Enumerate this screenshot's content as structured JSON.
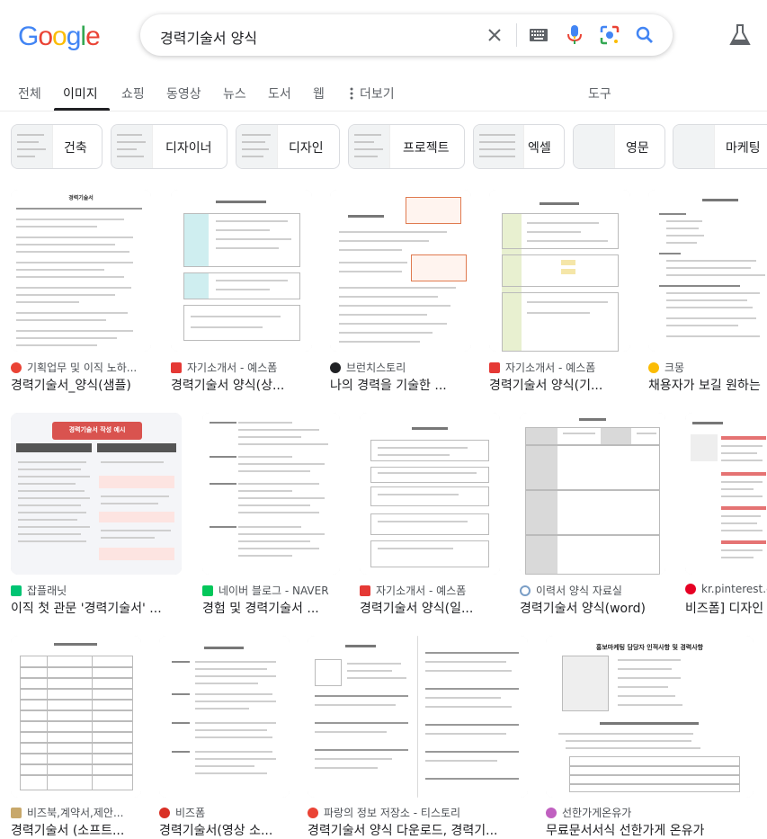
{
  "search": {
    "query": "경력기술서 양식"
  },
  "logo": {
    "letters": [
      "G",
      "o",
      "o",
      "g",
      "l",
      "e"
    ]
  },
  "tabs": {
    "all": "전체",
    "images": "이미지",
    "shopping": "쇼핑",
    "videos": "동영상",
    "news": "뉴스",
    "books": "도서",
    "web": "웹",
    "more": "더보기",
    "tools": "도구"
  },
  "chips": [
    "건축",
    "디자이너",
    "디자인",
    "프로젝트",
    "엑셀",
    "영문",
    "마케팅"
  ],
  "results": [
    {
      "source": "기획업무 및 이직 노하...",
      "title": "경력기술서_양식(샘플)"
    },
    {
      "source": "자기소개서 - 예스폼",
      "title": "경력기술서 양식(상..."
    },
    {
      "source": "브런치스토리",
      "title": "나의 경력을 기술한 ..."
    },
    {
      "source": "자기소개서 - 예스폼",
      "title": "경력기술서 양식(기..."
    },
    {
      "source": "크몽",
      "title": "채용자가 보길 원하는"
    },
    {
      "source": "잡플래닛",
      "title": "이직 첫 관문 '경력기술서' ..."
    },
    {
      "source": "네이버 블로그 - NAVER",
      "title": "경험 및 경력기술서 ..."
    },
    {
      "source": "자기소개서 - 예스폼",
      "title": "경력기술서 양식(일..."
    },
    {
      "source": "이력서 양식 자료실",
      "title": "경력기술서 양식(word)"
    },
    {
      "source": "kr.pinterest.c",
      "title": "비즈폼] 디자인"
    },
    {
      "source": "비즈북,계약서,제안...",
      "title": "경력기술서 (소프트..."
    },
    {
      "source": "비즈폼",
      "title": "경력기술서(영상 소..."
    },
    {
      "source": "파랑의 정보 저장소 - 티스토리",
      "title": "경력기술서 양식 다운로드, 경력기..."
    },
    {
      "source": "선한가게온유가",
      "title": "무료문서서식 선한가게 온유가"
    }
  ],
  "thumb_text": {
    "r1": "경력기술서",
    "r6_banner": "경력기술서 작성 예시",
    "r14_heading": "홍보마케팅 담당자 인적사항 및 경력사항"
  },
  "colors": {
    "logo_blue": "#4285F4",
    "logo_red": "#EA4335",
    "logo_yellow": "#FBBC05",
    "logo_green": "#34A853",
    "accent_red": "#d93025",
    "orange": "#e07a4f",
    "tab_active": "#202124"
  },
  "icons": [
    "clear-icon",
    "keyboard-icon",
    "microphone-icon",
    "lens-icon",
    "search-icon",
    "labs-icon",
    "more-dots-icon"
  ]
}
